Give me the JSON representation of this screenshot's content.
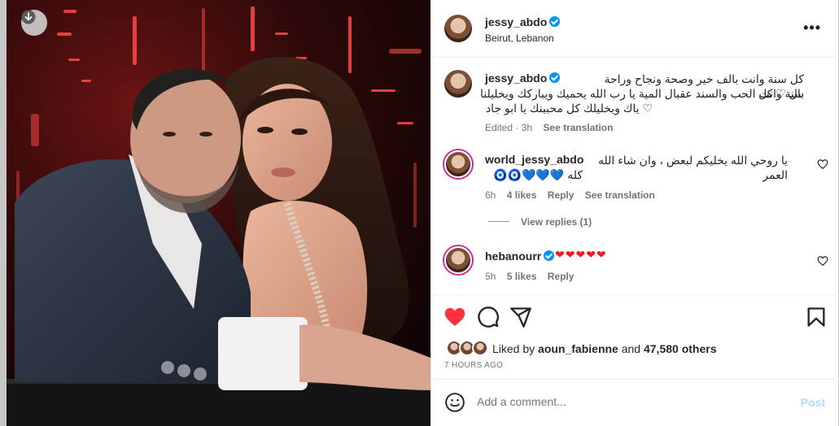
{
  "post": {
    "author": "jessy_abdo",
    "location": "Beirut, Lebanon",
    "caption": "كل سنة وانت بالف خير وصحة ونجاح وراحة بال ♡ كل سنة وانت الحب والسند عقبال المية يا رب الله يحميك ويباركك ويخليلنا ♡ ياك ويخليلك كل محبينك يا ابو جاد",
    "caption_line1": "كل سنة وانت بالف خير وصحة ونجاح وراحة بال ♡ كل",
    "caption_line2": "سنة وانت الحب والسند عقبال المية يا رب الله يحميك ويباركك ويخليلنا",
    "caption_line3": "♡ ياك ويخليلك كل محبينك يا ابو جاد",
    "edited_time": "Edited · 3h",
    "see_translation": "See translation"
  },
  "comments": [
    {
      "username": "world_jessy_abdo",
      "text_line1": "يا روحي الله يخليكم لبعض ، وان شاء الله العمر",
      "text_line2": "كله 💙💙💙🧿🧿",
      "time": "6h",
      "likes": "4 likes",
      "reply": "Reply",
      "see_translation": "See translation",
      "view_replies": "View replies (1)"
    },
    {
      "username": "hebanourr",
      "text": "❤❤❤❤❤",
      "time": "5h",
      "likes": "5 likes",
      "reply": "Reply"
    }
  ],
  "likes": {
    "prefix": "Liked by ",
    "user": "aoun_fabienne",
    "middle": " and ",
    "count": "47,580 others"
  },
  "time_ago": "7 HOURS AGO",
  "add_comment": {
    "placeholder": "Add a comment...",
    "post_label": "Post"
  },
  "colors": {
    "accent_blue": "#0095f6",
    "like_red": "#ff3040",
    "post_disabled": "#b3dbff"
  },
  "icons": [
    "download-icon",
    "more-options-icon",
    "verified-badge-icon",
    "heart-icon",
    "comment-icon",
    "share-icon",
    "bookmark-icon",
    "emoji-icon"
  ]
}
